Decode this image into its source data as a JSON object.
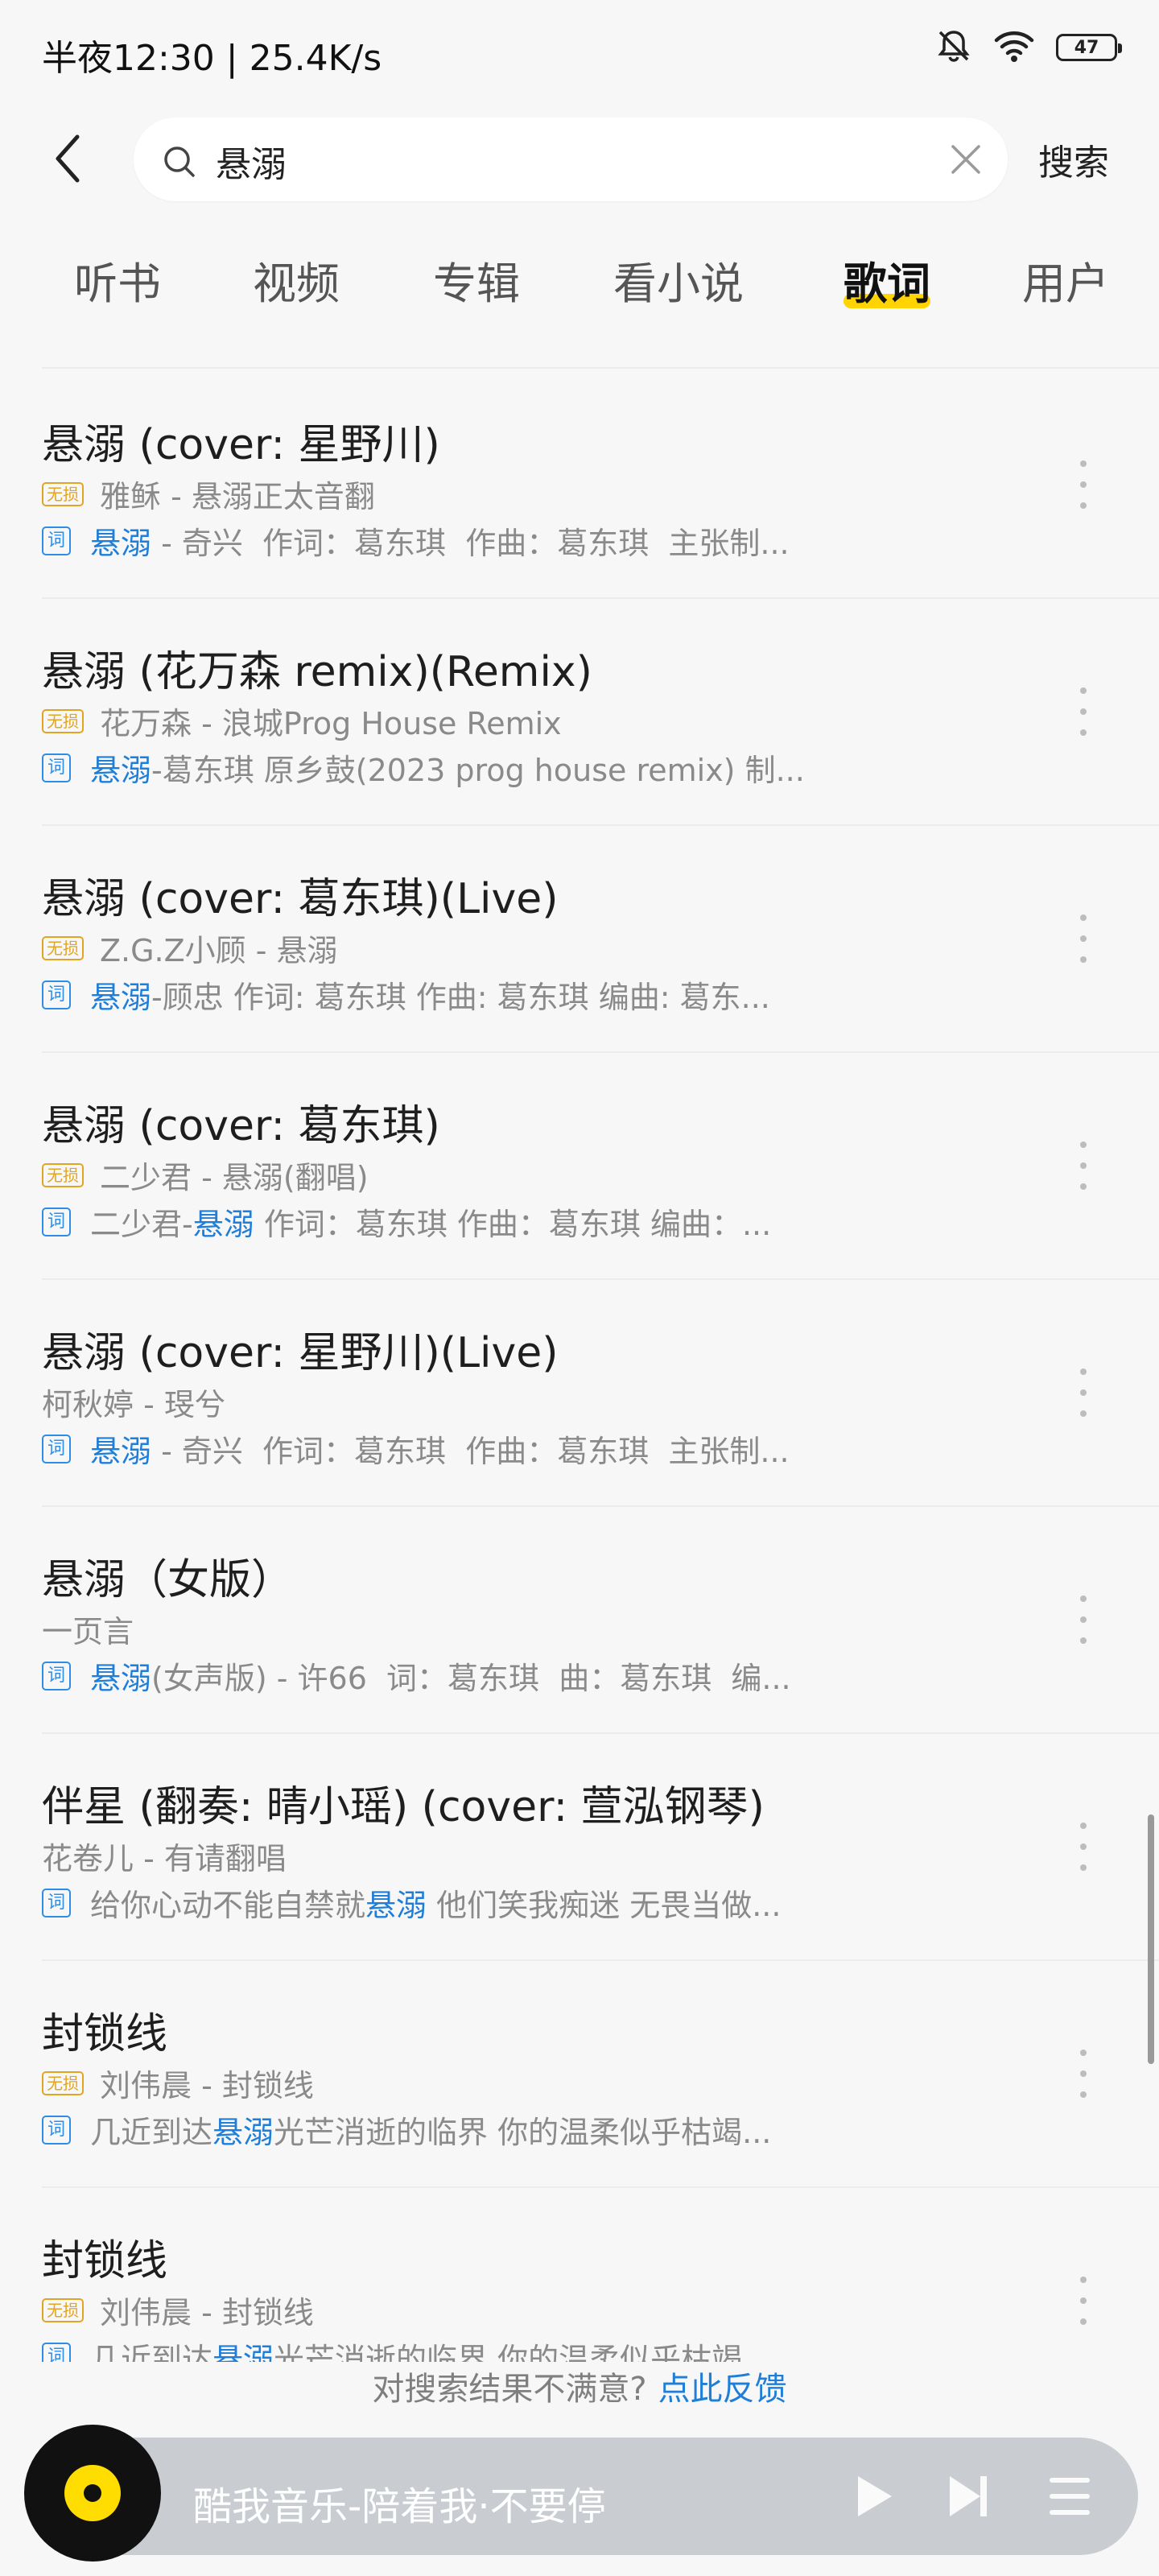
{
  "status": {
    "time": "半夜12:30 | 25.4K/s",
    "battery": "47"
  },
  "search": {
    "query": "悬溺",
    "submit_label": "搜索"
  },
  "tabs": [
    {
      "label": "听书"
    },
    {
      "label": "视频"
    },
    {
      "label": "专辑"
    },
    {
      "label": "看小说"
    },
    {
      "label": "歌词",
      "active": true
    },
    {
      "label": "用户"
    }
  ],
  "badges": {
    "lossless": "无损",
    "lyric": "词"
  },
  "results": [
    {
      "title": "悬溺 (cover: 星野川)",
      "lossless": true,
      "sub": "雅稣 - 悬溺正太音翻",
      "lyric_before": "",
      "lyric_highlight": "悬溺",
      "lyric_after": " - 奇兴  作词：葛东琪  作曲：葛东琪  主张制..."
    },
    {
      "title": "悬溺 (花万森 remix)(Remix)",
      "lossless": true,
      "sub": "花万森 - 浪城Prog House Remix",
      "lyric_before": "",
      "lyric_highlight": "悬溺",
      "lyric_after": "-葛东琪 原乡鼓(2023 prog house remix) 制..."
    },
    {
      "title": "悬溺 (cover: 葛东琪)(Live)",
      "lossless": true,
      "sub": "Z.G.Z小顾 - 悬溺",
      "lyric_before": "",
      "lyric_highlight": "悬溺",
      "lyric_after": "-顾忠 作词: 葛东琪 作曲: 葛东琪 编曲: 葛东..."
    },
    {
      "title": "悬溺 (cover: 葛东琪)",
      "lossless": true,
      "sub": "二少君 - 悬溺(翻唱)",
      "lyric_before": "二少君-",
      "lyric_highlight": "悬溺",
      "lyric_after": " 作词：葛东琪 作曲：葛东琪 编曲：..."
    },
    {
      "title": "悬溺 (cover: 星野川)(Live)",
      "lossless": false,
      "sub": "柯秋婷 - 琝兮",
      "lyric_before": "",
      "lyric_highlight": "悬溺",
      "lyric_after": " - 奇兴  作词：葛东琪  作曲：葛东琪  主张制..."
    },
    {
      "title": "悬溺（女版）",
      "lossless": false,
      "sub": "一页言",
      "lyric_before": "",
      "lyric_highlight": "悬溺",
      "lyric_after": "(女声版) - 许66  词：葛东琪  曲：葛东琪  编..."
    },
    {
      "title": "伴星 (翻奏: 晴小瑶) (cover: 萱泓钢琴)",
      "lossless": false,
      "sub": "花卷儿 - 有请翻唱",
      "lyric_before": "给你心动不能自禁就",
      "lyric_highlight": "悬溺",
      "lyric_after": " 他们笑我痴迷 无畏当做..."
    },
    {
      "title": "封锁线",
      "lossless": true,
      "sub": "刘伟晨 - 封锁线",
      "lyric_before": "几近到达",
      "lyric_highlight": "悬溺",
      "lyric_after": "光芒消逝的临界 你的温柔似乎枯竭..."
    },
    {
      "title": "封锁线",
      "lossless": true,
      "sub": "刘伟晨 - 封锁线",
      "lyric_before": "几近到达",
      "lyric_highlight": "悬溺",
      "lyric_after": "光芒消逝的临界 你的温柔似乎枯竭"
    }
  ],
  "feedback": {
    "text": "对搜索结果不满意?",
    "link": "点此反馈"
  },
  "player": {
    "title": "酷我音乐-陪着我·不要停"
  }
}
